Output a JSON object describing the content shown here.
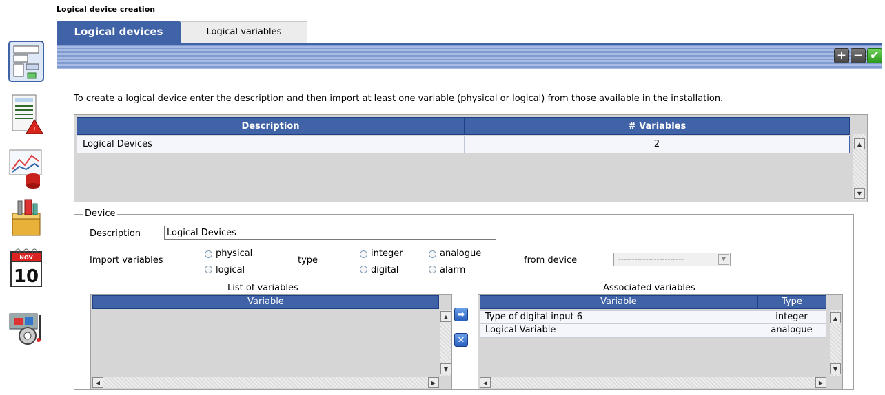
{
  "page_title": "Logical device creation",
  "sidebar": {
    "icons": [
      "logical-device-icon",
      "report-alarm-icon",
      "chart-database-icon",
      "toolbox-icon",
      "calendar-icon",
      "tools-settings-icon"
    ],
    "calendar_month": "NOV",
    "calendar_day": "10"
  },
  "tabs": [
    {
      "label": "Logical devices",
      "active": true
    },
    {
      "label": "Logical variables",
      "active": false
    }
  ],
  "toolbar": {
    "add": "+",
    "remove": "−",
    "confirm": "✔"
  },
  "instructions": "To create a logical device enter the description and then import at least one variable (physical or logical) from those available in the installation.",
  "devices_table": {
    "columns": [
      "Description",
      "# Variables"
    ],
    "rows": [
      {
        "description": "Logical Devices",
        "variables": "2"
      }
    ]
  },
  "device": {
    "legend": "Device",
    "description_label": "Description",
    "description_value": "Logical Devices",
    "import_label": "Import variables",
    "import_options": [
      "physical",
      "logical"
    ],
    "type_label": "type",
    "type_options": [
      "integer",
      "digital",
      "analogue",
      "alarm"
    ],
    "from_device_label": "from device",
    "from_device_value": "------------------------"
  },
  "list_of_variables": {
    "title": "List of variables",
    "columns": [
      "Variable"
    ]
  },
  "associated_variables": {
    "title": "Associated variables",
    "columns": [
      "Variable",
      "Type"
    ],
    "rows": [
      {
        "variable": "Type of digital input 6",
        "type": "integer"
      },
      {
        "variable": "Logical Variable",
        "type": "analogue"
      }
    ]
  },
  "colors": {
    "accent": "#3f63a6",
    "band": "#a7bbe4",
    "grid_bg": "#d6d6d6"
  }
}
